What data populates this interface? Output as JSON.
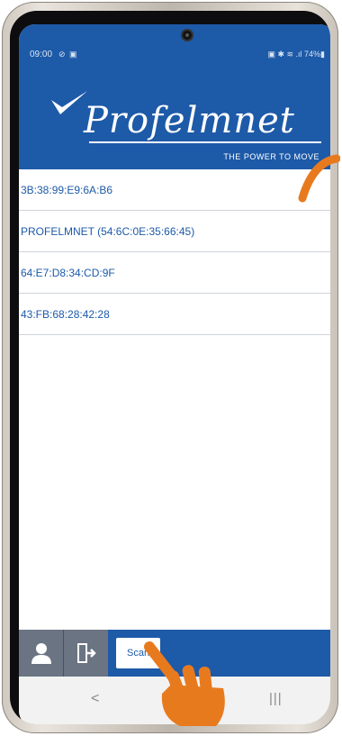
{
  "status_bar": {
    "time": "09:00",
    "left_icons": "⊘ ▣",
    "right": "▣ ✱ ≋ .ıl 74%▮"
  },
  "brand": {
    "name": "Profelmnet",
    "tagline": "THE POWER TO MOVE",
    "color": "#1d5aa8"
  },
  "devices": [
    {
      "label": "3B:38:99:E9:6A:B6"
    },
    {
      "label": "PROFELMNET (54:6C:0E:35:66:45)"
    },
    {
      "label": "64:E7:D8:34:CD:9F"
    },
    {
      "label": "43:FB:68:28:42:28"
    }
  ],
  "bottom_bar": {
    "scan_label": "Scan",
    "icons": [
      "user-icon",
      "exit-icon"
    ]
  },
  "nav": {
    "back": "<",
    "home": "",
    "recent": "|||"
  },
  "colors": {
    "primary": "#1d5aa8",
    "accent_orange": "#e87a1e",
    "gray_button": "#6a7482"
  }
}
